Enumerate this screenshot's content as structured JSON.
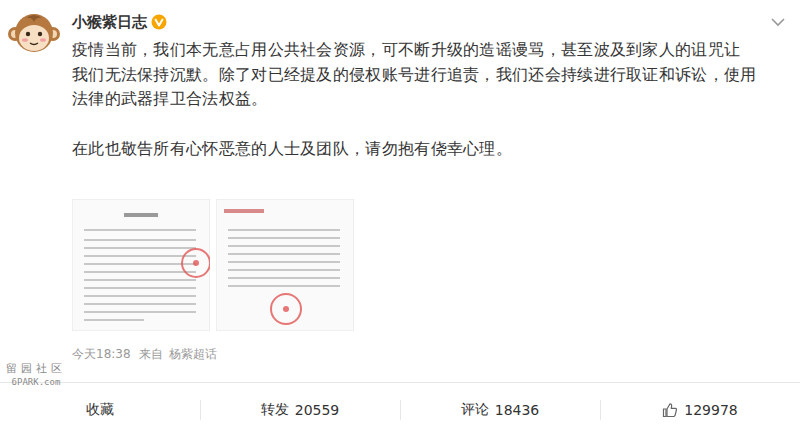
{
  "post": {
    "author": "小猴紫日志",
    "verified": true,
    "paragraphs": [
      {
        "lines": [
          "疫情当前，我们本无意占用公共社会资源，可不断升级的造谣谩骂，甚至波及到家人的诅咒让",
          "我们无法保持沉默。除了对已经提及的侵权账号进行追责，我们还会持续进行取证和诉讼，使用",
          "法律的武器捍卫合法权益。"
        ]
      },
      {
        "lines": [
          "在此也敬告所有心怀恶意的人士及团队，请勿抱有侥幸心理。"
        ]
      }
    ],
    "time": "今天18:38",
    "source_prefix": "来自",
    "source": "杨紫超话"
  },
  "watermark": {
    "brand": "留园社区",
    "site": "6PARK.com"
  },
  "actions": [
    {
      "kind": "text",
      "label": "收藏",
      "count": ""
    },
    {
      "kind": "text",
      "label": "转发",
      "count": "20559"
    },
    {
      "kind": "text",
      "label": "评论",
      "count": "18436"
    },
    {
      "kind": "like",
      "label": "",
      "count": "129978"
    }
  ]
}
